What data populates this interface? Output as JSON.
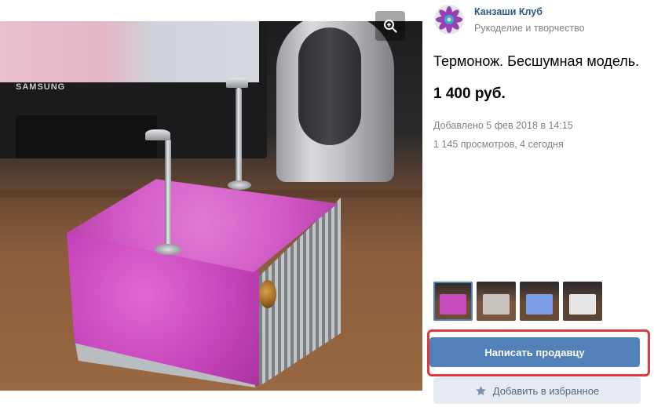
{
  "photo": {
    "monitor_brand": "SAMSUNG",
    "zoom_icon": "search-zoom-icon"
  },
  "shop": {
    "name": "Канзаши Клуб",
    "category": "Рукоделие и творчество",
    "avatar_icon": "kanzashi-flower-avatar"
  },
  "product": {
    "title": "Термонож. Бесшумная модель.",
    "price": "1 400 руб.",
    "added": "Добавлено 5 фев 2018 в 14:15",
    "views": "1 145 просмотров, 4 сегодня"
  },
  "thumbnails": [
    {
      "color": "#c64bbb",
      "bg": "#6c4c36",
      "active": true
    },
    {
      "color": "#c9c3bd",
      "bg": "#7a5640",
      "active": false
    },
    {
      "color": "#7c9ee8",
      "bg": "#6a4a34",
      "active": false
    },
    {
      "color": "#e7e7e7",
      "bg": "#5e4434",
      "active": false
    }
  ],
  "actions": {
    "write_seller": "Написать продавцу",
    "add_favorites": "Добавить в избранное"
  },
  "colors": {
    "accent": "#5181b8",
    "link": "#2a5885",
    "highlight": "#e23a3a",
    "secondary_button": "#e5ebf1"
  }
}
